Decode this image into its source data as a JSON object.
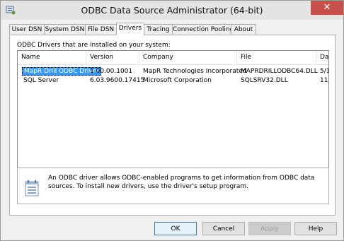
{
  "window": {
    "title": "ODBC Data Source Administrator (64-bit)",
    "close_glyph": "✕"
  },
  "tabs": [
    {
      "label": "User DSN"
    },
    {
      "label": "System DSN"
    },
    {
      "label": "File DSN"
    },
    {
      "label": "Drivers",
      "active": true
    },
    {
      "label": "Tracing"
    },
    {
      "label": "Connection Pooling"
    },
    {
      "label": "About"
    }
  ],
  "drivers": {
    "caption": "ODBC Drivers that are installed on your system:",
    "columns": [
      "Name",
      "Version",
      "Company",
      "File",
      "Dat"
    ],
    "rows": [
      {
        "name": "MapR Drill ODBC Driver",
        "version": "1.00.00.1001",
        "company": "MapR Technologies Incorporated",
        "file": "MAPRDRILLODBC64.DLL",
        "date": "5/1",
        "selected": true
      },
      {
        "name": "SQL Server",
        "version": "6.03.9600.17415",
        "company": "Microsoft Corporation",
        "file": "SQLSRV32.DLL",
        "date": "11/"
      }
    ]
  },
  "info": {
    "text": "An ODBC driver allows ODBC-enabled programs to get information from ODBC data sources.  To install new drivers, use the driver's setup program."
  },
  "buttons": {
    "ok": "OK",
    "cancel": "Cancel",
    "apply": "Apply",
    "help": "Help"
  },
  "colors": {
    "selection": "#3399ff",
    "close": "#c7504a"
  }
}
